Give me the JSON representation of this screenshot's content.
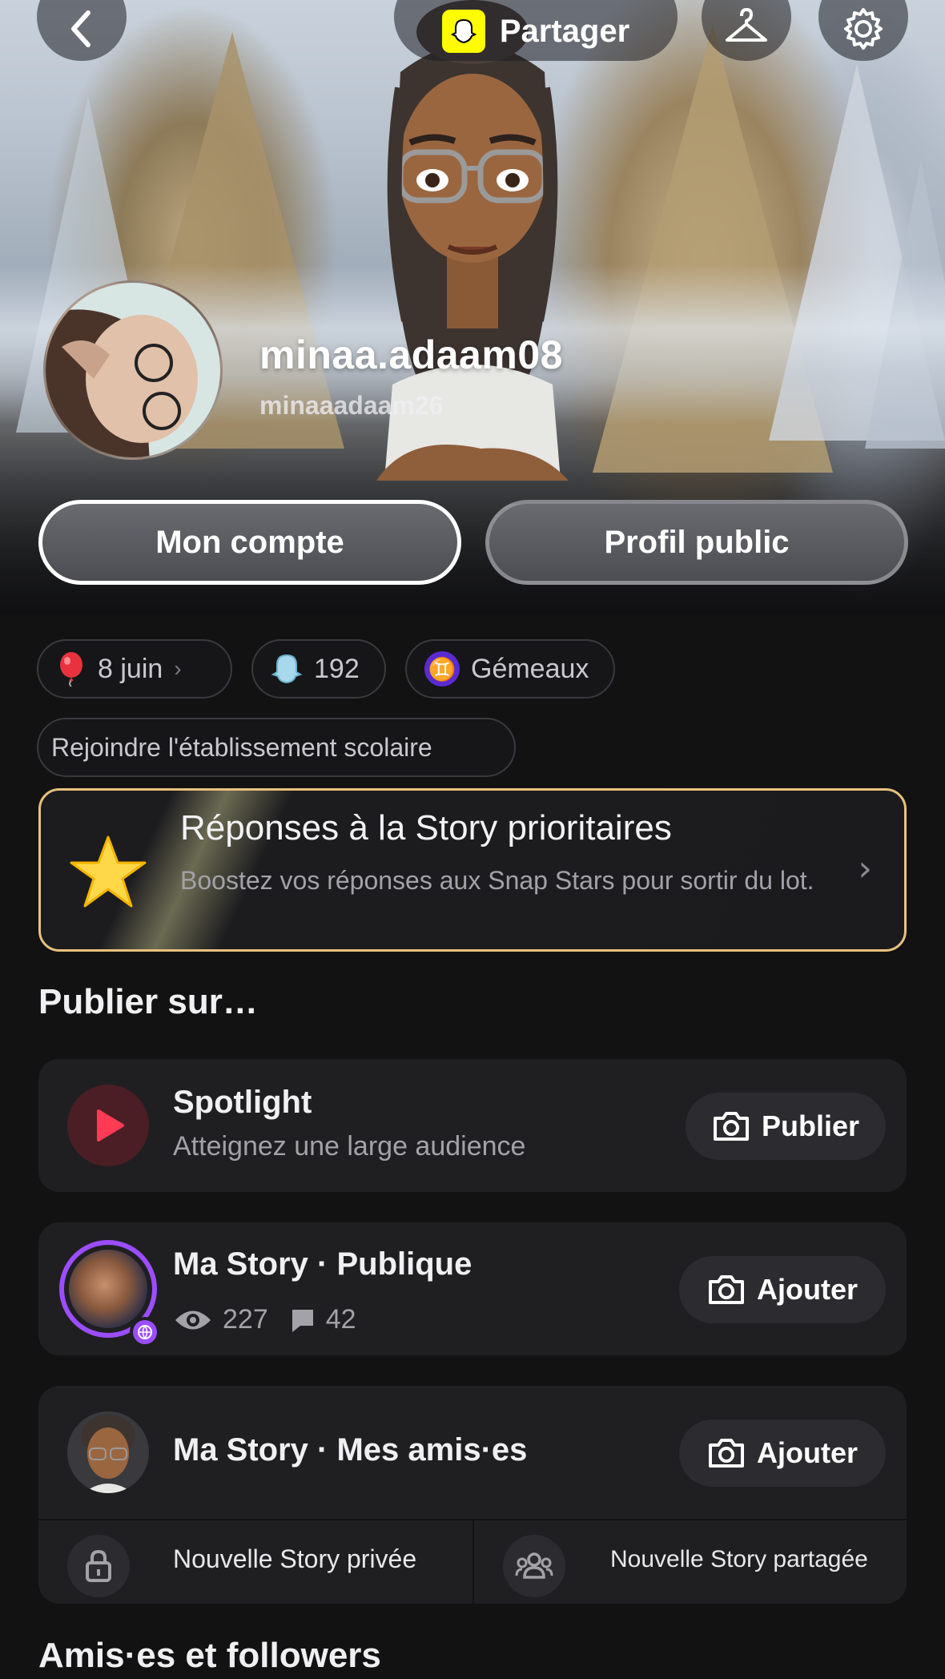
{
  "header": {
    "share_label": "Partager",
    "back_icon": "chevron-left-icon",
    "outfit_icon": "hanger-icon",
    "settings_icon": "gear-icon"
  },
  "profile": {
    "display_name": "minaa.adaam08",
    "username": "minaaadaam26"
  },
  "hero_buttons": {
    "account": "Mon compte",
    "public_profile": "Profil public"
  },
  "chips": {
    "birthday": "8 juin",
    "snapscore": "192",
    "zodiac_symbol": "♊",
    "zodiac": "Gémeaux",
    "school": "Rejoindre l'établissement scolaire"
  },
  "priority_card": {
    "title": "Réponses à la Story prioritaires",
    "description": "Boostez vos réponses aux Snap Stars pour sortir du lot."
  },
  "publish_section": {
    "title": "Publier sur…",
    "spotlight": {
      "title": "Spotlight",
      "subtitle": "Atteignez une large audience",
      "button": "Publier"
    },
    "public_story": {
      "title": "Ma Story · Publique",
      "views": "227",
      "replies": "42",
      "button": "Ajouter"
    },
    "friends_story": {
      "title": "Ma Story · Mes amis·es",
      "button": "Ajouter",
      "private_story": "Nouvelle Story privée",
      "shared_story": "Nouvelle Story partagée"
    }
  },
  "friends_section": {
    "title": "Amis·es et followers"
  },
  "colors": {
    "accent_purple": "#9b4dff",
    "spotlight_red": "#e8334a",
    "gold_border": "#e7c27d",
    "snap_yellow": "#fffc00"
  }
}
